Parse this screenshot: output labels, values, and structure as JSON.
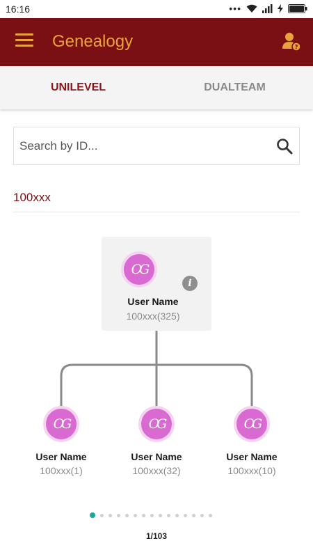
{
  "status_bar": {
    "time": "16:16",
    "dots": "•••"
  },
  "app_bar": {
    "title": "Genealogy",
    "accent_color": "#e8a33c",
    "background_color": "#7a1014"
  },
  "tabs": [
    {
      "label": "UNILEVEL",
      "active": true
    },
    {
      "label": "DUALTEAM",
      "active": false
    }
  ],
  "search": {
    "placeholder": "Search by ID...",
    "value": ""
  },
  "current_id": "100xxx",
  "tree": {
    "root": {
      "avatar_text": "OG",
      "name": "User Name",
      "id": "100xxx(325)"
    },
    "children": [
      {
        "avatar_text": "OG",
        "name": "User Name",
        "id": "100xxx(1)"
      },
      {
        "avatar_text": "OG",
        "name": "User Name",
        "id": "100xxx(32)"
      },
      {
        "avatar_text": "OG",
        "name": "User Name",
        "id": "100xxx(10)"
      }
    ]
  },
  "pager": {
    "total_dots": 15,
    "active_index": 0,
    "label": "1/103",
    "active_color": "#16a99c"
  },
  "icons": {
    "menu": "menu-icon",
    "user_help": "user-help-icon",
    "search": "search-icon",
    "info": "info-icon"
  }
}
